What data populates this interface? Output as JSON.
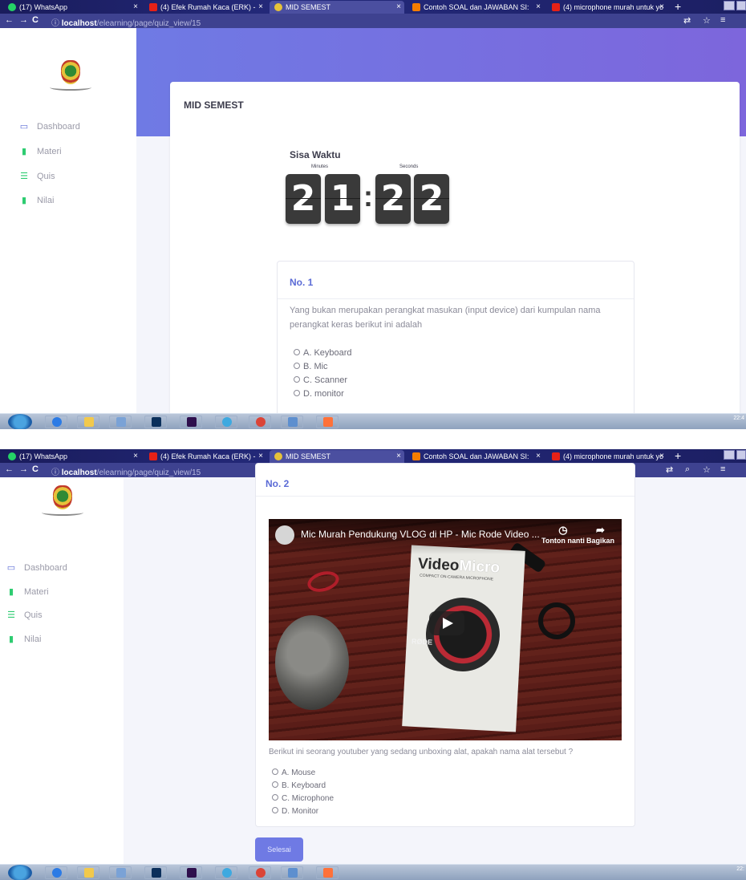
{
  "browser": {
    "tabs": [
      {
        "label": "(17) WhatsApp",
        "active": false,
        "favicon_color": "#25d366"
      },
      {
        "label": "(4) Efek Rumah Kaca (ERK) -",
        "active": false,
        "favicon_color": "#e62117"
      },
      {
        "label": "MID SEMEST",
        "active": true,
        "favicon_color": "#e6c23a"
      },
      {
        "label": "Contoh SOAL dan JAWABAN SI:",
        "active": false,
        "favicon_color": "#f57d00"
      },
      {
        "label": "(4) microphone murah untuk yo",
        "active": false,
        "favicon_color": "#e62117"
      }
    ],
    "close_glyph": "×",
    "new_tab_glyph": "+",
    "back_glyph": "←",
    "forward_glyph": "→",
    "reload_glyph": "C",
    "info_glyph": "ⓘ",
    "url_host": "localhost",
    "url_path": "/elearning/page/quiz_view/15",
    "translate_glyph": "⇄",
    "zoom_glyph": "⌕",
    "star_glyph": "☆",
    "playlist_glyph": "≡"
  },
  "sidebar": {
    "items": [
      {
        "label": "Dashboard",
        "icon": "monitor-icon",
        "glyph": "▭",
        "color": "#5b6bd6"
      },
      {
        "label": "Materi",
        "icon": "book-icon",
        "glyph": "▮",
        "color": "#2ecc71"
      },
      {
        "label": "Quis",
        "icon": "list-icon",
        "glyph": "☰",
        "color": "#2ecc71"
      },
      {
        "label": "Nilai",
        "icon": "clipboard-icon",
        "glyph": "▮",
        "color": "#2ecc71"
      }
    ]
  },
  "quiz": {
    "title": "MID SEMEST",
    "timer": {
      "label": "Sisa Waktu",
      "minutes_caption": "Minutes",
      "seconds_caption": "Seconds",
      "digits": [
        "2",
        "1",
        "2",
        "2"
      ],
      "separator": ":"
    },
    "questions": [
      {
        "number": "No. 1",
        "text": "Yang bukan merupakan perangkat masukan  (input device) dari kumpulan nama perangkat keras berikut ini adalah",
        "options": [
          "A. Keyboard",
          "B. Mic",
          "C. Scanner",
          "D. monitor"
        ]
      },
      {
        "number": "No. 2",
        "video": {
          "title": "Mic Murah Pendukung VLOG di HP - Mic Rode Video ...",
          "watch_later": "Tonton nanti",
          "share": "Bagikan",
          "watch_later_glyph": "◷",
          "share_glyph": "➦",
          "box_brand_main": "Video",
          "box_brand_accent": "Micro",
          "box_subtitle": "COMPACT ON-CAMERA MICROPHONE",
          "box_maker": "RØDE"
        },
        "text": "Berikut ini seorang youtuber yang sedang unboxing alat, apakah nama alat tersebut ?",
        "options": [
          "A. Mouse",
          "B. Keyboard",
          "C. Microphone",
          "D. Monitor"
        ]
      }
    ],
    "submit_label": "Selesai"
  },
  "taskbar": {
    "apps": [
      "ie-icon",
      "folder-icon",
      "media-icon",
      "photoshop-icon",
      "premiere-icon",
      "bird-icon",
      "chrome-icon",
      "network-icon",
      "firefox-icon"
    ],
    "clock_top": "22:4",
    "clock_bottom": "22:"
  },
  "colors": {
    "accent": "#6f7ae4",
    "question_number": "#5b6bd6",
    "sidebar_active_icon": "#2ecc71"
  }
}
